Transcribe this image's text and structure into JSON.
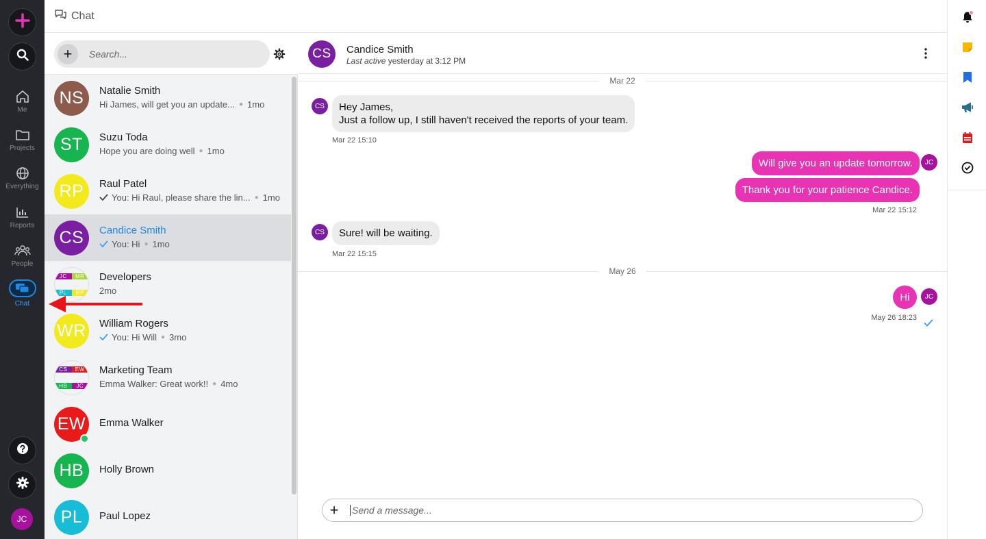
{
  "app": {
    "topbar_title": "Chat"
  },
  "rail": {
    "items": [
      {
        "label": "Me",
        "icon": "home-icon"
      },
      {
        "label": "Projects",
        "icon": "folder-icon"
      },
      {
        "label": "Everything",
        "icon": "globe-icon"
      },
      {
        "label": "Reports",
        "icon": "bar-chart-icon"
      },
      {
        "label": "People",
        "icon": "people-icon"
      },
      {
        "label": "Chat",
        "icon": "chat-icon"
      }
    ],
    "user_initials": "JC",
    "accent": "#e733b4",
    "active_color": "#3aa0ff"
  },
  "search": {
    "placeholder": "Search..."
  },
  "conversations": [
    {
      "initials": "NS",
      "name": "Natalie Smith",
      "preview": "Hi James, will get you an update...",
      "time": "1mo",
      "color": "#8d5b4c",
      "check": ""
    },
    {
      "initials": "ST",
      "name": "Suzu Toda",
      "preview": "Hope you are doing well",
      "time": "1mo",
      "color": "#16b54f",
      "check": ""
    },
    {
      "initials": "RP",
      "name": "Raul Patel",
      "preview": "You: Hi Raul, please share the lin...",
      "time": "1mo",
      "color": "#f2ea1c",
      "check": "gray"
    },
    {
      "initials": "CS",
      "name": "Candice Smith",
      "preview": "You: Hi",
      "time": "1mo",
      "color": "#7b1fa2",
      "check": "blue"
    },
    {
      "name": "Developers",
      "preview": "",
      "time": "2mo",
      "group": [
        [
          "JC",
          "#a6129b"
        ],
        [
          "MR",
          "#a8d63a"
        ],
        [
          "PL",
          "#17bcd6"
        ],
        [
          "RP",
          "#f2ea1c"
        ]
      ]
    },
    {
      "initials": "WR",
      "name": "William Rogers",
      "preview": "You: Hi Will",
      "time": "3mo",
      "color": "#f2ea1c",
      "check": "blue"
    },
    {
      "name": "Marketing Team",
      "preview": "Emma Walker: Great work!!",
      "time": "4mo",
      "group": [
        [
          "CS",
          "#7b1fa2"
        ],
        [
          "EW",
          "#e81a1a"
        ],
        [
          "HB",
          "#16b54f"
        ],
        [
          "JC",
          "#a6129b"
        ]
      ]
    },
    {
      "initials": "EW",
      "name": "Emma Walker",
      "preview": "",
      "time": "",
      "color": "#e81a1a",
      "online": true
    },
    {
      "initials": "HB",
      "name": "Holly Brown",
      "preview": "",
      "time": "",
      "color": "#16b54f"
    },
    {
      "initials": "PL",
      "name": "Paul Lopez",
      "preview": "",
      "time": "",
      "color": "#17bcd6"
    }
  ],
  "chat": {
    "initials": "CS",
    "name": "Candice Smith",
    "status_italic": "Last active",
    "status_rest": " yesterday at 3:12 PM",
    "messages": {
      "sep1": "Mar 22",
      "in1_line1": "Hey James,",
      "in1_line2": "Just a follow up, I still haven't received the reports of your team.",
      "in1_time": "Mar 22 15:10",
      "out1": "Will give you an update tomorrow.",
      "out2": "Thank you for your patience Candice.",
      "out_time": "Mar 22 15:12",
      "in2": "Sure! will be waiting.",
      "in2_time": "Mar 22 15:15",
      "sep2": "May 26",
      "out3": "Hi",
      "out3_time": "May 26 18:23",
      "sender_initials": "CS",
      "me_initials": "JC"
    },
    "composer_placeholder": "Send a message..."
  },
  "right_rail": {
    "icons": [
      {
        "name": "bell-icon",
        "color": "#111111"
      },
      {
        "name": "sticky-note-icon",
        "color": "#f5b800"
      },
      {
        "name": "bookmark-icon",
        "color": "#1e6ee5"
      },
      {
        "name": "megaphone-icon",
        "color": "#2a6f8a"
      },
      {
        "name": "calendar-icon",
        "color": "#e01818"
      },
      {
        "name": "timer-icon",
        "color": "#111111"
      }
    ]
  }
}
